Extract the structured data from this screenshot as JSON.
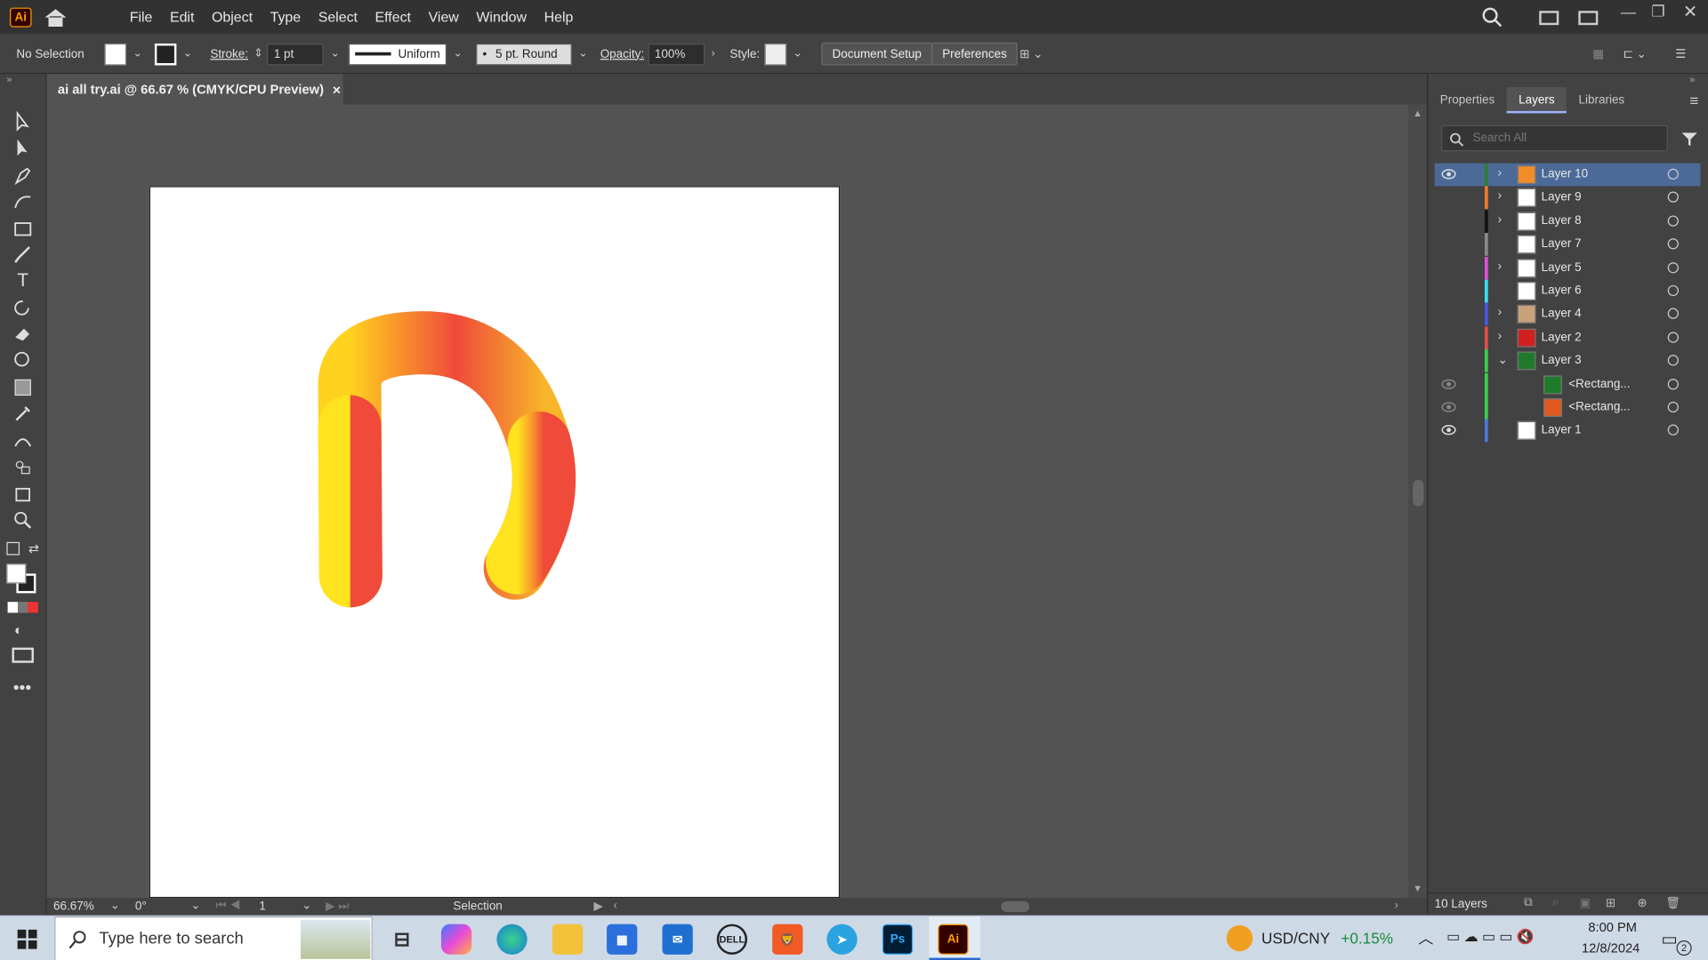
{
  "app": {
    "logo": "Ai",
    "menu": [
      "File",
      "Edit",
      "Object",
      "Type",
      "Select",
      "Effect",
      "View",
      "Window",
      "Help"
    ]
  },
  "control": {
    "selection": "No Selection",
    "stroke_label": "Stroke:",
    "stroke_value": "1 pt",
    "profile": "Uniform",
    "brush": "5 pt. Round",
    "opacity_label": "Opacity:",
    "opacity_value": "100%",
    "style_label": "Style:",
    "doc_setup": "Document Setup",
    "preferences": "Preferences"
  },
  "document": {
    "tab": "ai all try.ai @ 66.67 % (CMYK/CPU Preview)",
    "close": "×"
  },
  "status": {
    "zoom": "66.67%",
    "rotation": "0°",
    "artboard": "1",
    "tool": "Selection"
  },
  "panel": {
    "tabs": [
      "Properties",
      "Layers",
      "Libraries"
    ],
    "search_placeholder": "Search All",
    "footer": "10 Layers",
    "layers": [
      {
        "name": "Layer 10",
        "color": "#2f7d32",
        "expand": "›",
        "selected": true,
        "eye": true,
        "thumb": "#f28c28"
      },
      {
        "name": "Layer 9",
        "color": "#f07a28",
        "expand": "›",
        "selected": false,
        "eye": false,
        "thumb": "#ffffff"
      },
      {
        "name": "Layer 8",
        "color": "#111111",
        "expand": "›",
        "selected": false,
        "eye": false,
        "thumb": "#ffffff"
      },
      {
        "name": "Layer 7",
        "color": "#8a8a8a",
        "expand": "",
        "selected": false,
        "eye": false,
        "thumb": "#ffffff"
      },
      {
        "name": "Layer 5",
        "color": "#e04fd8",
        "expand": "›",
        "selected": false,
        "eye": false,
        "thumb": "#ffffff"
      },
      {
        "name": "Layer 6",
        "color": "#37e0f0",
        "expand": "",
        "selected": false,
        "eye": false,
        "thumb": "#ffffff"
      },
      {
        "name": "Layer 4",
        "color": "#4a55e0",
        "expand": "›",
        "selected": false,
        "eye": false,
        "thumb": "#c9a27a"
      },
      {
        "name": "Layer 2",
        "color": "#e54b4b",
        "expand": "›",
        "selected": false,
        "eye": false,
        "thumb": "#d02020"
      },
      {
        "name": "Layer 3",
        "color": "#3ad04a",
        "expand": "⌄",
        "selected": false,
        "eye": false,
        "thumb": "#1f7a2a"
      },
      {
        "name": "<Rectang...",
        "color": "#3ad04a",
        "expand": "",
        "selected": false,
        "eye": true,
        "thumb": "#1f7a2a",
        "child": true
      },
      {
        "name": "<Rectang...",
        "color": "#3ad04a",
        "expand": "",
        "selected": false,
        "eye": true,
        "thumb": "#e05a20",
        "child": true
      },
      {
        "name": "Layer 1",
        "color": "#4a7ae0",
        "expand": "",
        "selected": false,
        "eye": true,
        "thumb": "#ffffff"
      }
    ]
  },
  "taskbar": {
    "search_placeholder": "Type here to search",
    "currency": "USD/CNY",
    "change": "+0.15%",
    "time": "8:00 PM",
    "date": "12/8/2024",
    "notif": "2"
  }
}
